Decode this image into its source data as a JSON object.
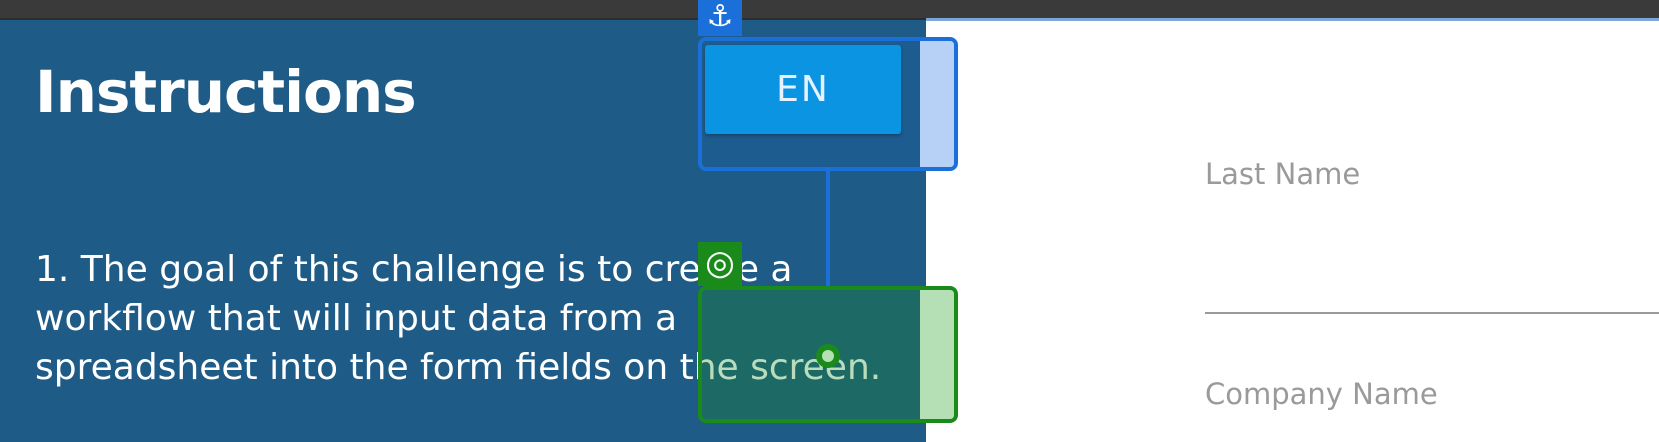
{
  "left_panel": {
    "title": "Instructions",
    "instruction_text": "1. The goal of this challenge is to create a workflow that will input data from a spreadsheet into the form fields on the screen."
  },
  "language_button": {
    "label": "EN"
  },
  "form": {
    "last_name_label": "Last Name",
    "company_name_label": "Company Name"
  },
  "overlay": {
    "anchor_icon": "anchor-icon",
    "target_icon": "target-icon"
  },
  "colors": {
    "panel_bg": "#1e5b87",
    "anchor_accent": "#1a6fd8",
    "target_accent": "#1a8a1a",
    "language_button": "#0b94e1"
  }
}
